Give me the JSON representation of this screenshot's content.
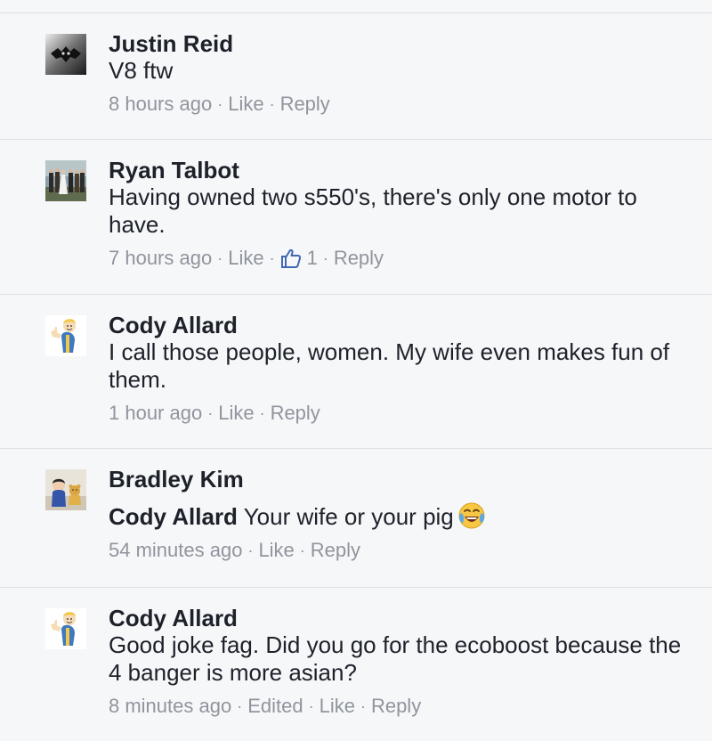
{
  "comments": [
    {
      "author": "Justin Reid",
      "text": "V8 ftw",
      "time": "8 hours ago",
      "like_label": "Like",
      "reply_label": "Reply",
      "avatar": "bat-avatar"
    },
    {
      "author": "Ryan Talbot",
      "text": "Having owned two s550's, there's only one motor to have.",
      "time": "7 hours ago",
      "like_label": "Like",
      "reply_label": "Reply",
      "like_count": "1",
      "avatar": "wedding-group-avatar"
    },
    {
      "author": "Cody Allard",
      "text": "I call those people, women. My wife even makes fun of them.",
      "time": "1 hour ago",
      "like_label": "Like",
      "reply_label": "Reply",
      "avatar": "vault-boy-avatar"
    },
    {
      "author": "Bradley Kim",
      "mention": "Cody Allard",
      "text": " Your wife or your pig",
      "emoji": "tears-of-joy-emoji",
      "time": "54 minutes ago",
      "like_label": "Like",
      "reply_label": "Reply",
      "avatar": "child-with-teddy-avatar"
    },
    {
      "author": "Cody Allard",
      "text": "Good joke fag. Did you go for the ecoboost because the 4 banger is more asian?",
      "time": "8 minutes ago",
      "edited_label": "Edited",
      "like_label": "Like",
      "reply_label": "Reply",
      "avatar": "vault-boy-avatar"
    }
  ],
  "colors": {
    "background": "#f6f7f9",
    "text": "#1d2129",
    "meta": "#90949c",
    "divider": "#dddfe2",
    "like_blue": "#4267b2"
  }
}
